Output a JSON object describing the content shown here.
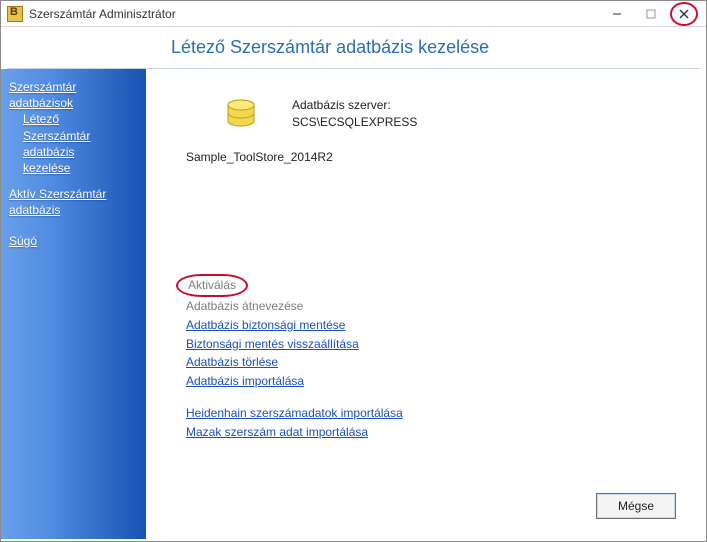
{
  "window": {
    "title": "Szerszámtár Adminisztrátor"
  },
  "heading": "Létező Szerszámtár adatbázis kezelése",
  "sidebar": {
    "group1_line1": "Szerszámtár",
    "group1_line2": "adatbázisok",
    "sub_line1": "Létező",
    "sub_line2": "Szerszámtár",
    "sub_line3": "adatbázis",
    "sub_line4": "kezelése",
    "group2_line1": "Aktív Szerszámtár",
    "group2_line2": "adatbázis",
    "group3": "Súgó"
  },
  "main": {
    "server_label": "Adatbázis szerver:",
    "server_value": "SCS\\ECSQLEXPRESS",
    "db_name": "Sample_ToolStore_2014R2"
  },
  "actions": {
    "activate": "Aktiválás",
    "rename": "Adatbázis átnevezése",
    "backup": "Adatbázis biztonsági mentése",
    "restore": "Biztonsági mentés visszaállítása",
    "delete": "Adatbázis törlése",
    "import": "Adatbázis importálása",
    "heidenhain": "Heidenhain szerszámadatok importálása",
    "mazak": "Mazak szerszám adat importálása"
  },
  "buttons": {
    "cancel": "Mégse"
  }
}
